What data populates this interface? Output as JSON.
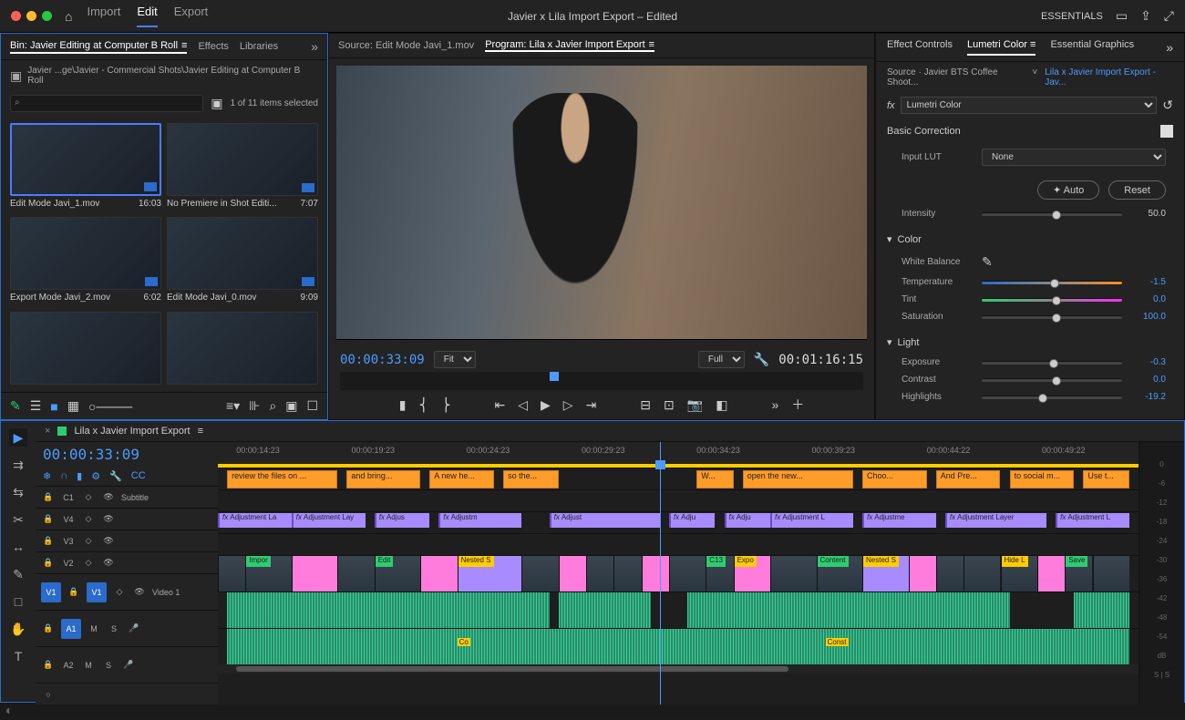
{
  "titlebar": {
    "menu": {
      "import": "Import",
      "edit": "Edit",
      "export": "Export"
    },
    "title": "Javier x Lila Import Export – Edited",
    "workspace_label": "ESSENTIALS"
  },
  "project": {
    "tab_bin": "Bin: Javier Editing at Computer B Roll",
    "tab_effects": "Effects",
    "tab_libraries": "Libraries",
    "breadcrumb": "Javier ...ge\\Javier - Commercial Shots\\Javier Editing at Computer B Roll",
    "search_placeholder": "",
    "selection": "1 of 11 items selected",
    "clips": [
      {
        "name": "Edit Mode Javi_1.mov",
        "dur": "16:03"
      },
      {
        "name": "No Premiere in Shot Editi...",
        "dur": "7:07"
      },
      {
        "name": "Export Mode Javi_2.mov",
        "dur": "6:02"
      },
      {
        "name": "Edit Mode Javi_0.mov",
        "dur": "9:09"
      }
    ]
  },
  "source": {
    "tab": "Source: Edit Mode Javi_1.mov"
  },
  "program": {
    "tab": "Program: Lila x Javier Import Export",
    "tc_in": "00:00:33:09",
    "fit": "Fit",
    "full": "Full",
    "tc_out": "00:01:16:15"
  },
  "lumetri": {
    "tabs": {
      "fx": "Effect Controls",
      "lc": "Lumetri Color",
      "eg": "Essential Graphics"
    },
    "source": "Source · Javier BTS Coffee Shoot...",
    "sequence": "Lila x Javier Import Export - Jav...",
    "fx_name": "Lumetri Color",
    "section_basic": "Basic Correction",
    "input_lut_label": "Input LUT",
    "input_lut_value": "None",
    "auto": "Auto",
    "reset": "Reset",
    "intensity": {
      "lbl": "Intensity",
      "val": "50.0"
    },
    "color": "Color",
    "wb": "White Balance",
    "temp": {
      "lbl": "Temperature",
      "val": "-1.5"
    },
    "tint": {
      "lbl": "Tint",
      "val": "0.0"
    },
    "sat": {
      "lbl": "Saturation",
      "val": "100.0"
    },
    "light": "Light",
    "exp": {
      "lbl": "Exposure",
      "val": "-0.3"
    },
    "con": {
      "lbl": "Contrast",
      "val": "0.0"
    },
    "hl": {
      "lbl": "Highlights",
      "val": "-19.2"
    }
  },
  "timeline": {
    "seq_name": "Lila x Javier Import Export",
    "tc": "00:00:33:09",
    "marks": [
      "00:00:14:23",
      "00:00:19:23",
      "00:00:24:23",
      "00:00:29:23",
      "00:00:34:23",
      "00:00:39:23",
      "00:00:44:22",
      "00:00:49:22"
    ],
    "tracks": {
      "c1": "C1",
      "sub": "Subtitle",
      "v4": "V4",
      "v3": "V3",
      "v2": "V2",
      "v1": "V1",
      "v1lbl": "Video 1",
      "a1": "A1",
      "a2": "A2"
    },
    "captions": [
      "review the files on ...",
      "and bring...",
      "A new he...",
      "so the...",
      "W...",
      "open the new...",
      "Choo...",
      "And Pre...",
      "to social m...",
      "Use t..."
    ],
    "adjustments": [
      "Adjustment La",
      "Adjustment Lay",
      "Adjus",
      "Adjustm",
      "Adjust",
      "Adju",
      "Adju",
      "Adjustment L",
      "Adjustme",
      "Adjustment Layer",
      "Adjustment L"
    ],
    "v1clips": [
      "Impor",
      "Edit",
      "Nested S",
      "C13",
      "Expo",
      "Content",
      "Nested S",
      "Hide L",
      "Save"
    ],
    "audio_markers": [
      "Co",
      "Const"
    ]
  },
  "meters": [
    "0",
    "-6",
    "-12",
    "-18",
    "-24",
    "-30",
    "-36",
    "-42",
    "-48",
    "-54",
    "dB",
    "S | S"
  ]
}
